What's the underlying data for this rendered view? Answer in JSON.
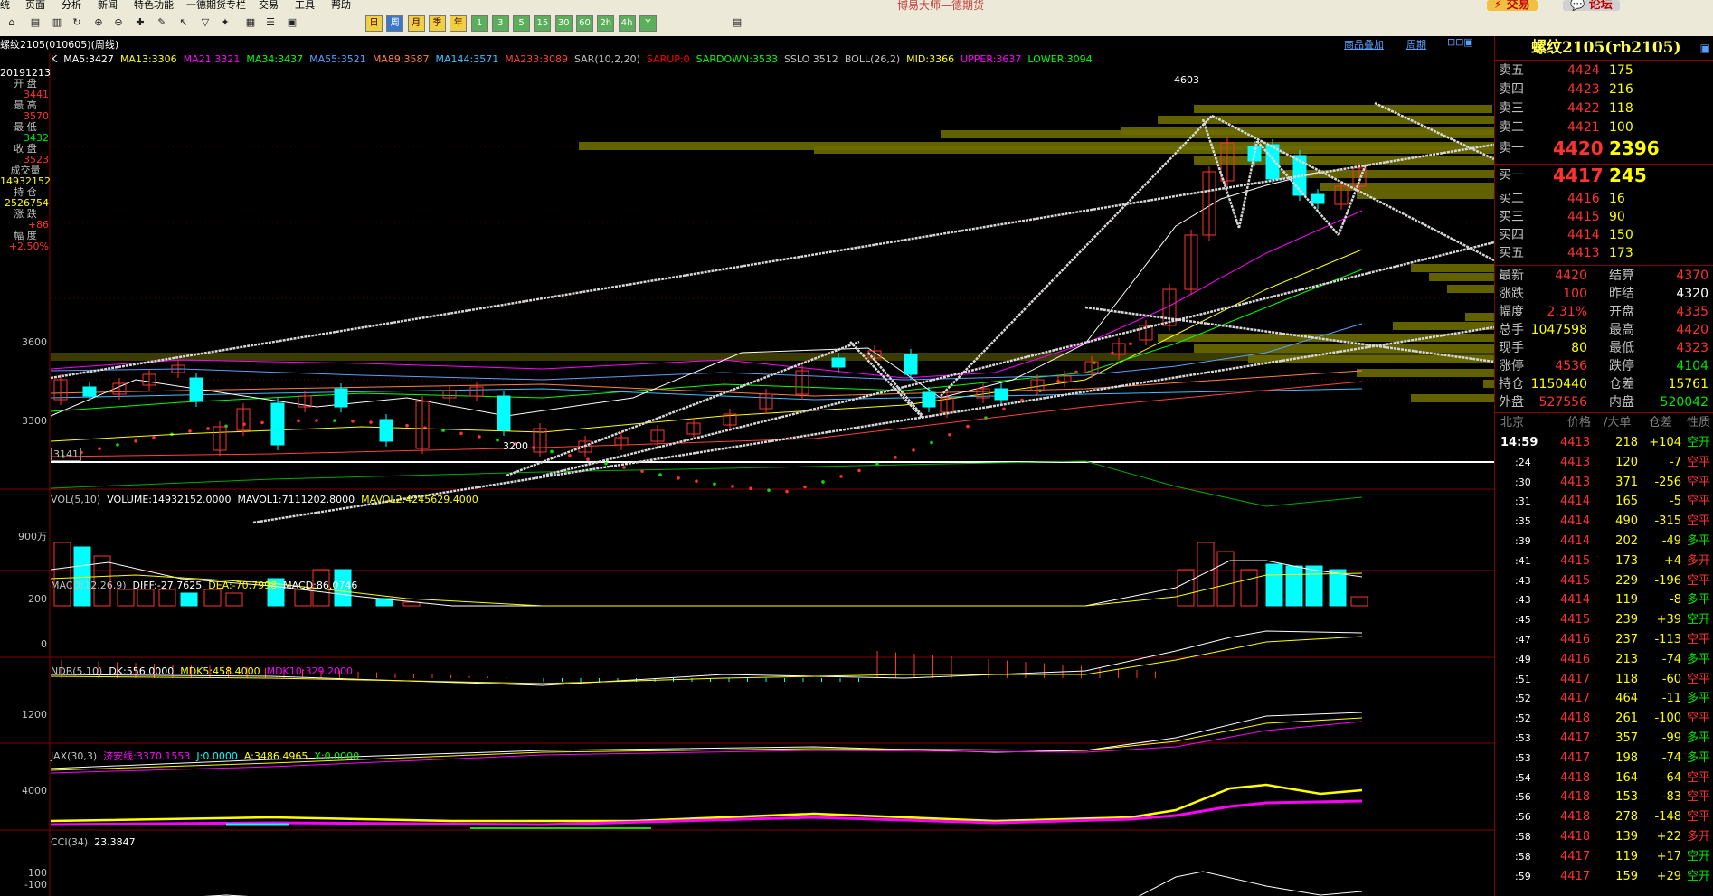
{
  "menu": [
    "统",
    "页面",
    "分析",
    "新闻",
    "特色功能",
    "一德期货专栏",
    "交易",
    "工具",
    "帮助"
  ],
  "window_title": "博易大师—德期货",
  "top_buttons": {
    "trade": "交易",
    "forum": "论坛"
  },
  "toolbar": {
    "timeframes": [
      "日",
      "周",
      "月",
      "季",
      "年",
      "1",
      "3",
      "5",
      "15",
      "30",
      "60",
      "2h",
      "4h",
      "Y"
    ]
  },
  "header": {
    "symbol": "螺纹2105(010605)(周线)",
    "overlay_link": "商品叠加",
    "period_link": "周期"
  },
  "main_legend": [
    {
      "text": "K",
      "color": "#ffffff"
    },
    {
      "text": "MA5:3427",
      "color": "#ffffff"
    },
    {
      "text": "MA13:3306",
      "color": "#ffff00"
    },
    {
      "text": "MA21:3321",
      "color": "#ff00ff"
    },
    {
      "text": "MA34:3437",
      "color": "#00ff00"
    },
    {
      "text": "MA55:3521",
      "color": "#5aa0ff"
    },
    {
      "text": "MA89:3587",
      "color": "#ff8040"
    },
    {
      "text": "MA144:3571",
      "color": "#40c0ff"
    },
    {
      "text": "MA233:3089",
      "color": "#ff4040"
    },
    {
      "text": "SAR(10,2,20)",
      "color": "#c0c0c0"
    },
    {
      "text": "SARUP:0",
      "color": "#ff0000"
    },
    {
      "text": "SARDOWN:3533",
      "color": "#00ff00"
    },
    {
      "text": "SSLO 3512",
      "color": "#c0c0c0"
    },
    {
      "text": "BOLL(26,2)",
      "color": "#c0c0c0"
    },
    {
      "text": "MID:3366",
      "color": "#ffff00"
    },
    {
      "text": "UPPER:3637",
      "color": "#ff00ff"
    },
    {
      "text": "LOWER:3094",
      "color": "#00ff00"
    }
  ],
  "left_info": {
    "date": "20191213",
    "items": [
      {
        "label": "开 盘",
        "value": "3441",
        "color": "#ff3232"
      },
      {
        "label": "最 高",
        "value": "3570",
        "color": "#ff3232"
      },
      {
        "label": "最 低",
        "value": "3432",
        "color": "#00e600"
      },
      {
        "label": "收 盘",
        "value": "3523",
        "color": "#ff3232"
      },
      {
        "label": "成交量",
        "value": "14932152",
        "color": "#ffff00"
      },
      {
        "label": "持 仓",
        "value": "2526754",
        "color": "#ffff00"
      },
      {
        "label": "涨 跌",
        "value": "+86",
        "color": "#ff3232"
      },
      {
        "label": "幅 度",
        "value": "+2.50%",
        "color": "#ff3232"
      }
    ]
  },
  "main_axis": {
    "labels": [
      "3600",
      "3300"
    ],
    "low_label": "3141",
    "high_mark": "4603",
    "low_mark": "3200"
  },
  "vol_legend": [
    {
      "text": "VOL(5,10)",
      "color": "#c0c0c0"
    },
    {
      "text": "VOLUME:14932152.0000",
      "color": "#ffffff"
    },
    {
      "text": "MAVOL1:7111202.8000",
      "color": "#ffffff"
    },
    {
      "text": "MAVOL2:4245629.4000",
      "color": "#ffff00"
    }
  ],
  "vol_axis": "900万",
  "macd_legend": [
    {
      "text": "MACD(12,26,9)",
      "color": "#c0c0c0"
    },
    {
      "text": "DIFF:-27.7625",
      "color": "#ffffff"
    },
    {
      "text": "DEA:-70.7998",
      "color": "#ffff00"
    },
    {
      "text": "MACD:86.0746",
      "color": "#ffffff"
    }
  ],
  "macd_axis": [
    "200",
    "0"
  ],
  "ndb_legend": [
    {
      "text": "NDB(5,10)",
      "color": "#c0c0c0"
    },
    {
      "text": "DK:556.0000",
      "color": "#ffffff"
    },
    {
      "text": "MDK5:458.4000",
      "color": "#ffff00"
    },
    {
      "text": "MDK10:329.2000",
      "color": "#ff00ff"
    }
  ],
  "ndb_axis": "1200",
  "jax_legend": [
    {
      "text": "JAX(30,3)",
      "color": "#c0c0c0"
    },
    {
      "text": "济安线:3370.1553",
      "color": "#ff00ff"
    },
    {
      "text": "J:0.0000",
      "color": "#00ffff"
    },
    {
      "text": "A:3486.4965",
      "color": "#ffff00"
    },
    {
      "text": "X:0.0000",
      "color": "#00ff00"
    }
  ],
  "jax_axis": "4000",
  "cci_legend": [
    {
      "text": "CCI(34)",
      "color": "#c0c0c0"
    },
    {
      "text": "23.3847",
      "color": "#ffffff"
    }
  ],
  "cci_axis": [
    "100",
    "-100"
  ],
  "quote": {
    "title": "螺纹2105(rb2105)",
    "asks": [
      {
        "label": "卖五",
        "price": "4424",
        "vol": "175"
      },
      {
        "label": "卖四",
        "price": "4423",
        "vol": "216"
      },
      {
        "label": "卖三",
        "price": "4422",
        "vol": "118"
      },
      {
        "label": "卖二",
        "price": "4421",
        "vol": "100"
      },
      {
        "label": "卖一",
        "price": "4420",
        "vol": "2396"
      }
    ],
    "bids": [
      {
        "label": "买一",
        "price": "4417",
        "vol": "245"
      },
      {
        "label": "买二",
        "price": "4416",
        "vol": "16"
      },
      {
        "label": "买三",
        "price": "4415",
        "vol": "90"
      },
      {
        "label": "买四",
        "price": "4414",
        "vol": "150"
      },
      {
        "label": "买五",
        "price": "4413",
        "vol": "173"
      }
    ],
    "stats": [
      {
        "l1": "最新",
        "v1": "4420",
        "c1": "#ff3232",
        "l2": "结算",
        "v2": "4370",
        "c2": "#ff3232"
      },
      {
        "l1": "涨跌",
        "v1": "100",
        "c1": "#ff3232",
        "l2": "昨结",
        "v2": "4320",
        "c2": "#ffffff"
      },
      {
        "l1": "幅度",
        "v1": "2.31%",
        "c1": "#ff3232",
        "l2": "开盘",
        "v2": "4335",
        "c2": "#ff3232"
      },
      {
        "l1": "总手",
        "v1": "1047598",
        "c1": "#ffff00",
        "l2": "最高",
        "v2": "4420",
        "c2": "#ff3232"
      },
      {
        "l1": "现手",
        "v1": "80",
        "c1": "#ffff00",
        "l2": "最低",
        "v2": "4323",
        "c2": "#ff3232"
      },
      {
        "l1": "涨停",
        "v1": "4536",
        "c1": "#ff3232",
        "l2": "跌停",
        "v2": "4104",
        "c2": "#00e600"
      },
      {
        "l1": "持仓",
        "v1": "1150440",
        "c1": "#ffff00",
        "l2": "仓差",
        "v2": "15761",
        "c2": "#ffff00"
      },
      {
        "l1": "外盘",
        "v1": "527556",
        "c1": "#ff3232",
        "l2": "内盘",
        "v2": "520042",
        "c2": "#00e600"
      }
    ],
    "tick_header": [
      "北京",
      "价格",
      "/大单",
      "仓差",
      "性质"
    ],
    "ticks": [
      {
        "t": "14:59",
        "p": "4413",
        "v": "218",
        "d": "+104",
        "n": "空开",
        "nc": "#00e600"
      },
      {
        "t": ":24",
        "p": "4413",
        "v": "120",
        "d": "-7",
        "n": "空平",
        "nc": "#ff3232"
      },
      {
        "t": ":30",
        "p": "4413",
        "v": "371",
        "d": "-256",
        "n": "空平",
        "nc": "#ff3232"
      },
      {
        "t": ":31",
        "p": "4414",
        "v": "165",
        "d": "-5",
        "n": "空平",
        "nc": "#ff3232"
      },
      {
        "t": ":35",
        "p": "4414",
        "v": "490",
        "d": "-315",
        "n": "空平",
        "nc": "#ff3232"
      },
      {
        "t": ":39",
        "p": "4414",
        "v": "202",
        "d": "-49",
        "n": "多平",
        "nc": "#00e600"
      },
      {
        "t": ":41",
        "p": "4415",
        "v": "173",
        "d": "+4",
        "n": "多开",
        "nc": "#ff3232"
      },
      {
        "t": ":43",
        "p": "4415",
        "v": "229",
        "d": "-196",
        "n": "空平",
        "nc": "#ff3232"
      },
      {
        "t": ":43",
        "p": "4414",
        "v": "119",
        "d": "-8",
        "n": "多平",
        "nc": "#00e600"
      },
      {
        "t": ":45",
        "p": "4415",
        "v": "239",
        "d": "+39",
        "n": "空开",
        "nc": "#00e600"
      },
      {
        "t": ":47",
        "p": "4416",
        "v": "237",
        "d": "-113",
        "n": "空平",
        "nc": "#ff3232"
      },
      {
        "t": ":49",
        "p": "4416",
        "v": "213",
        "d": "-74",
        "n": "多平",
        "nc": "#00e600"
      },
      {
        "t": ":51",
        "p": "4417",
        "v": "118",
        "d": "-60",
        "n": "空平",
        "nc": "#ff3232"
      },
      {
        "t": ":52",
        "p": "4417",
        "v": "464",
        "d": "-11",
        "n": "多平",
        "nc": "#00e600"
      },
      {
        "t": ":52",
        "p": "4418",
        "v": "261",
        "d": "-100",
        "n": "空平",
        "nc": "#ff3232"
      },
      {
        "t": ":53",
        "p": "4417",
        "v": "357",
        "d": "-99",
        "n": "多平",
        "nc": "#00e600"
      },
      {
        "t": ":53",
        "p": "4417",
        "v": "198",
        "d": "-74",
        "n": "多平",
        "nc": "#00e600"
      },
      {
        "t": ":54",
        "p": "4418",
        "v": "164",
        "d": "-64",
        "n": "空平",
        "nc": "#ff3232"
      },
      {
        "t": ":56",
        "p": "4418",
        "v": "153",
        "d": "-83",
        "n": "空平",
        "nc": "#ff3232"
      },
      {
        "t": ":56",
        "p": "4418",
        "v": "278",
        "d": "-148",
        "n": "空平",
        "nc": "#ff3232"
      },
      {
        "t": ":58",
        "p": "4418",
        "v": "139",
        "d": "+22",
        "n": "多开",
        "nc": "#ff3232"
      },
      {
        "t": ":58",
        "p": "4417",
        "v": "119",
        "d": "+17",
        "n": "空开",
        "nc": "#00e600"
      },
      {
        "t": ":59",
        "p": "4417",
        "v": "159",
        "d": "+29",
        "n": "空开",
        "nc": "#00e600"
      }
    ]
  }
}
